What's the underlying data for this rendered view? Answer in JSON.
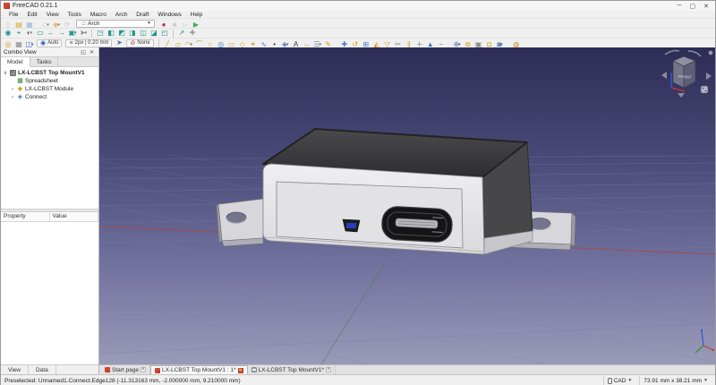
{
  "window": {
    "title": "FreeCAD 0.21.1",
    "minimize": "─",
    "maximize": "▢",
    "close": "✕"
  },
  "menu": {
    "items": [
      "File",
      "Edit",
      "View",
      "Tools",
      "Macro",
      "Arch",
      "Draft",
      "Windows",
      "Help"
    ]
  },
  "toolbars": {
    "workbench_selector": "Arch",
    "row1_file": [
      {
        "n": "new-file-icon",
        "g": "▯",
        "c": "#c9c9c9"
      },
      {
        "n": "open-file-icon",
        "g": "▤",
        "c": "#d9a62e"
      },
      {
        "n": "save-file-icon",
        "g": "▦",
        "c": "#9db6d9"
      },
      {
        "sep": true
      },
      {
        "n": "paste-icon",
        "g": "◇",
        "c": "#d0d0d0",
        "dd": true
      },
      {
        "n": "undo-icon",
        "g": "◆",
        "c": "#e0c27a",
        "dd": true
      },
      {
        "n": "refresh-icon",
        "g": "⟳",
        "c": "#c9c9c9"
      }
    ],
    "row1_macro": [
      {
        "n": "macro-record-icon",
        "g": "●",
        "c": "#cc2b2b"
      },
      {
        "n": "macro-stop-icon",
        "g": "■",
        "c": "#cccccc"
      },
      {
        "n": "macro-edit-icon",
        "g": "▻",
        "c": "#cccccc"
      },
      {
        "n": "macro-play-icon",
        "g": "▶",
        "c": "#49a94f"
      }
    ],
    "row2": [
      {
        "n": "fit-all-icon",
        "g": "◉",
        "c": "#20948b"
      },
      {
        "n": "zoom-icon",
        "g": "⌖",
        "c": "#20948b"
      },
      {
        "n": "draw-style-icon",
        "g": "◐",
        "c": "#555555",
        "dd": true
      },
      {
        "n": "box-select-icon",
        "g": "▭",
        "c": "#20948b"
      },
      {
        "n": "nav-back-icon",
        "g": "←",
        "c": "#20948b"
      },
      {
        "n": "nav-forward-icon",
        "g": "→",
        "c": "#20948b"
      },
      {
        "n": "link-view-icon",
        "g": "▣",
        "c": "#20948b",
        "dd": true
      },
      {
        "n": "pointer-icon",
        "g": "➤",
        "c": "#888888",
        "dd": true
      },
      {
        "sep": true
      },
      {
        "n": "view-isometric-icon",
        "g": "◳",
        "c": "#20948b"
      },
      {
        "n": "view-front-icon",
        "g": "◧",
        "c": "#20948b"
      },
      {
        "n": "view-top-icon",
        "g": "◩",
        "c": "#20948b"
      },
      {
        "n": "view-right-icon",
        "g": "◨",
        "c": "#20948b"
      },
      {
        "n": "view-rear-icon",
        "g": "◫",
        "c": "#20948b"
      },
      {
        "n": "view-bottom-icon",
        "g": "◪",
        "c": "#20948b"
      },
      {
        "n": "view-left-icon",
        "g": "◰",
        "c": "#20948b"
      },
      {
        "sep": true
      },
      {
        "n": "measure-icon",
        "g": "↗",
        "c": "#20948b"
      },
      {
        "n": "clip-plane-icon",
        "g": "✚",
        "c": "#999999"
      }
    ],
    "row3_left": [
      {
        "n": "snap-lock-icon",
        "g": "◎",
        "c": "#d4a017"
      },
      {
        "n": "snap-grid-icon",
        "g": "▦",
        "c": "#8a8a8a"
      },
      {
        "n": "working-plane-icon",
        "g": "◫",
        "c": "#4a78c0",
        "dd": true
      }
    ],
    "row3_auto_label": "Auto",
    "row3_linewidth_label": "2px | 0.20 mm",
    "row3_autogroup_label": "None",
    "row3_draft": [
      {
        "n": "draft-line-icon",
        "g": "╱",
        "c": "#d4a017"
      },
      {
        "n": "draft-polyline-icon",
        "g": "▱",
        "c": "#d4a017"
      },
      {
        "n": "draft-fillet-icon",
        "g": "◠",
        "c": "#d4a017",
        "dd": true
      },
      {
        "n": "draft-arc-icon",
        "g": "⌒",
        "c": "#d4a017"
      },
      {
        "n": "draft-circle-icon",
        "g": "○",
        "c": "#d4a017"
      },
      {
        "n": "draft-ellipse-icon",
        "g": "◎",
        "c": "#4a78c0"
      },
      {
        "n": "draft-rectangle-icon",
        "g": "▭",
        "c": "#d4a017"
      },
      {
        "n": "draft-polygon-icon",
        "g": "◇",
        "c": "#d4a017"
      },
      {
        "n": "draft-star-icon",
        "g": "✶",
        "c": "#d4a017"
      },
      {
        "n": "draft-bspline-icon",
        "g": "∿",
        "c": "#4a78c0"
      },
      {
        "n": "draft-point-icon",
        "g": "•",
        "c": "#3a3a3a"
      },
      {
        "n": "draft-facebinder-icon",
        "g": "◈",
        "c": "#4a78c0",
        "dd": true
      },
      {
        "n": "draft-text-icon",
        "g": "A",
        "c": "#3a3a3a"
      },
      {
        "n": "draft-dimension-icon",
        "g": "↔",
        "c": "#d4a017"
      },
      {
        "n": "draft-label-icon",
        "g": "☰",
        "c": "#888888",
        "dd": true
      },
      {
        "n": "draft-annotation-icon",
        "g": "✎",
        "c": "#d4a017"
      },
      {
        "sep": true
      },
      {
        "n": "draft-move-icon",
        "g": "✚",
        "c": "#4a78c0"
      },
      {
        "n": "draft-rotate-icon",
        "g": "↺",
        "c": "#d4a017"
      },
      {
        "n": "draft-scale-icon",
        "g": "⊞",
        "c": "#4a78c0"
      },
      {
        "n": "draft-mirror-icon",
        "g": "◭",
        "c": "#d4a017"
      },
      {
        "n": "draft-offset-icon",
        "g": "▽",
        "c": "#d4a017"
      },
      {
        "n": "draft-trim-icon",
        "g": "✂",
        "c": "#888888"
      },
      {
        "n": "draft-join-icon",
        "g": "∥",
        "c": "#d4a017"
      },
      {
        "n": "draft-split-icon",
        "g": "＋",
        "c": "#777777"
      },
      {
        "n": "draft-upgrade-icon",
        "g": "▲",
        "c": "#4a78c0"
      },
      {
        "n": "draft-downgrade-icon",
        "g": "−",
        "c": "#777777"
      },
      {
        "sep": true
      },
      {
        "n": "draft-array-icon",
        "g": "⊕",
        "c": "#4a78c0",
        "dd": true
      },
      {
        "n": "draft-clone-icon",
        "g": "⧉",
        "c": "#d4a017"
      },
      {
        "n": "draft-drawing-icon",
        "g": "▣",
        "c": "#888888"
      },
      {
        "n": "draft-heal-icon",
        "g": "◘",
        "c": "#d4a017"
      },
      {
        "n": "draft-layer-icon",
        "g": "◙",
        "c": "#4a78c0",
        "dd": true
      },
      {
        "sep": true
      },
      {
        "n": "draft-lock-icon",
        "g": "◍",
        "c": "#c98f1b"
      }
    ]
  },
  "combo_view": {
    "title": "Combo View",
    "float_icon": "◱",
    "close_icon": "✕",
    "tabs": [
      "Model",
      "Tasks"
    ],
    "active_tab": "Model",
    "tree": [
      {
        "caret": "∨",
        "icon": "part-document-icon",
        "label": "LX-LCBST Top MountV1",
        "bold": true,
        "indent": 0
      },
      {
        "caret": "",
        "icon": "spreadsheet-icon",
        "glyph": "▦",
        "label": "Spreadsheet",
        "indent": 1
      },
      {
        "caret": "›",
        "icon": "module-icon",
        "glyph": "◆",
        "label": "LX-LCBST Module",
        "indent": 1
      },
      {
        "caret": "›",
        "icon": "connect-icon",
        "glyph": "◈",
        "label": "Connect",
        "indent": 1
      }
    ],
    "property_columns": [
      "Property",
      "Value"
    ],
    "bottom_tabs": [
      "View",
      "Data"
    ]
  },
  "viewport": {
    "nav_cube_label": "FRONT",
    "background_top": "#2c2c55",
    "background_bottom": "#9a9bb8",
    "grid_color": "#7b7bab",
    "x_axis_color": "#a84848",
    "y_axis_color": "#4a7a4a"
  },
  "document_tabs": [
    {
      "icon": "freecad-doc-icon",
      "label": "Start page",
      "close": "✕",
      "active": false
    },
    {
      "icon": "freecad-doc-icon",
      "label": "LX-LCBST Top MountV1 : 1*",
      "close": "✕",
      "active": true
    },
    {
      "icon": "spreadsheet-doc-icon",
      "label": "LX-LCBST Top MountV1*",
      "close": "✕",
      "active": false
    }
  ],
  "status_bar": {
    "message": "Preselected: Unnamed1.Connect.Edge128 (-11.313163 mm, -2.000000 mm, 9.210000 mm)",
    "nav_style": "CAD",
    "dimensions": "73.91 mm x 38.21 mm"
  }
}
